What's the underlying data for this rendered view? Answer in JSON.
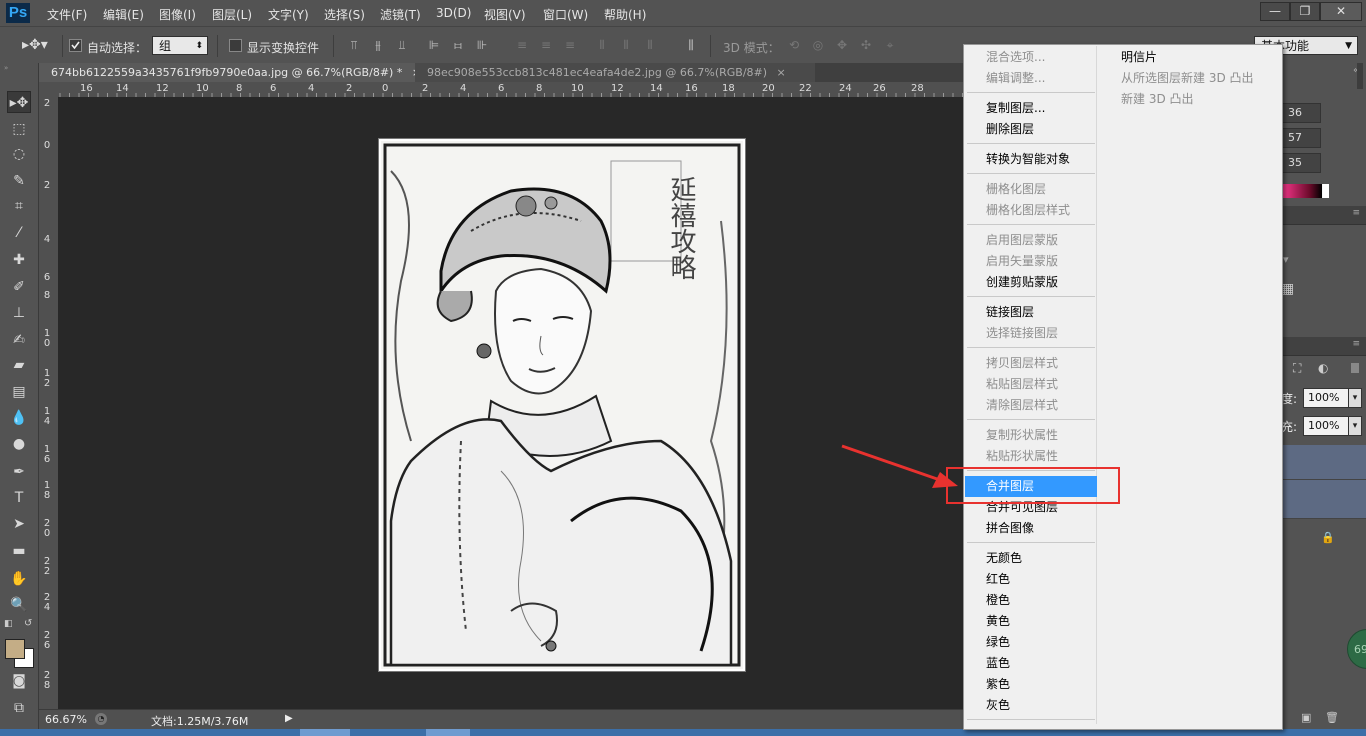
{
  "menubar": {
    "logo": "Ps",
    "items": [
      "文件(F)",
      "编辑(E)",
      "图像(I)",
      "图层(L)",
      "文字(Y)",
      "选择(S)",
      "滤镜(T)",
      "3D(D)",
      "视图(V)",
      "窗口(W)",
      "帮助(H)"
    ],
    "window_buttons": [
      "—",
      "❐",
      "✕"
    ]
  },
  "options": {
    "auto_select_label": "自动选择：",
    "auto_select_checked": true,
    "group_value": "组",
    "show_transform_label": "显示变换控件",
    "mode_3d_label": "3D 模式：",
    "workspace_value": "基本功能"
  },
  "tabs": [
    {
      "label": "674bb6122559a3435761f9fb9790e0aa.jpg @ 66.7%(RGB/8#) *",
      "close": "×"
    },
    {
      "label": "98ec908e553ccb813c481ec4eafa4de2.jpg @ 66.7%(RGB/8#)",
      "close": "×"
    }
  ],
  "hruler_labels": [
    "16",
    "14",
    "12",
    "10",
    "8",
    "6",
    "4",
    "2",
    "0",
    "2",
    "4",
    "6",
    "8",
    "10",
    "12",
    "14",
    "16",
    "18",
    "20",
    "22",
    "24",
    "26",
    "28"
  ],
  "vruler_labels": [
    "2",
    "0",
    "2",
    "4",
    "6",
    "8",
    "10",
    "12",
    "14",
    "16",
    "18",
    "20",
    "22",
    "24",
    "26",
    "28"
  ],
  "statusbar": {
    "zoom": "66.67%",
    "doc": "文档:1.25M/3.76M"
  },
  "rightpanel": {
    "fields": [
      "36",
      "57",
      "35"
    ],
    "opacity_label": "度:",
    "opacity_value": "100%",
    "fill_label": "充:",
    "fill_value": "100%",
    "badge": "69"
  },
  "context_menu": {
    "col1": [
      {
        "label": "混合选项...",
        "enabled": false
      },
      {
        "label": "编辑调整...",
        "enabled": false
      },
      {
        "label": "复制图层...",
        "enabled": true
      },
      {
        "label": "删除图层",
        "enabled": true
      },
      {
        "label": "转换为智能对象",
        "enabled": true
      },
      {
        "label": "栅格化图层",
        "enabled": false
      },
      {
        "label": "栅格化图层样式",
        "enabled": false
      },
      {
        "label": "启用图层蒙版",
        "enabled": false
      },
      {
        "label": "启用矢量蒙版",
        "enabled": false
      },
      {
        "label": "创建剪贴蒙版",
        "enabled": true
      },
      {
        "label": "链接图层",
        "enabled": true
      },
      {
        "label": "选择链接图层",
        "enabled": false
      },
      {
        "label": "拷贝图层样式",
        "enabled": false
      },
      {
        "label": "粘贴图层样式",
        "enabled": false
      },
      {
        "label": "清除图层样式",
        "enabled": false
      },
      {
        "label": "复制形状属性",
        "enabled": false
      },
      {
        "label": "粘贴形状属性",
        "enabled": false
      },
      {
        "label": "合并图层",
        "enabled": true,
        "highlighted": true
      },
      {
        "label": "合并可见图层",
        "enabled": true
      },
      {
        "label": "拼合图像",
        "enabled": true
      },
      {
        "label": "无颜色",
        "enabled": true
      },
      {
        "label": "红色",
        "enabled": true
      },
      {
        "label": "橙色",
        "enabled": true
      },
      {
        "label": "黄色",
        "enabled": true
      },
      {
        "label": "绿色",
        "enabled": true
      },
      {
        "label": "蓝色",
        "enabled": true
      },
      {
        "label": "紫色",
        "enabled": true
      },
      {
        "label": "灰色",
        "enabled": true
      }
    ],
    "col2": [
      {
        "label": "明信片",
        "enabled": true
      },
      {
        "label": "从所选图层新建 3D 凸出",
        "enabled": false
      },
      {
        "label": "新建 3D 凸出",
        "enabled": false
      }
    ]
  },
  "photo_watermark": "延禧攻略",
  "colors": {
    "highlight": "#3399ff",
    "annotation": "#e8322f",
    "fg_swatch": "#c4ad86",
    "bg_swatch": "#ffffff"
  }
}
